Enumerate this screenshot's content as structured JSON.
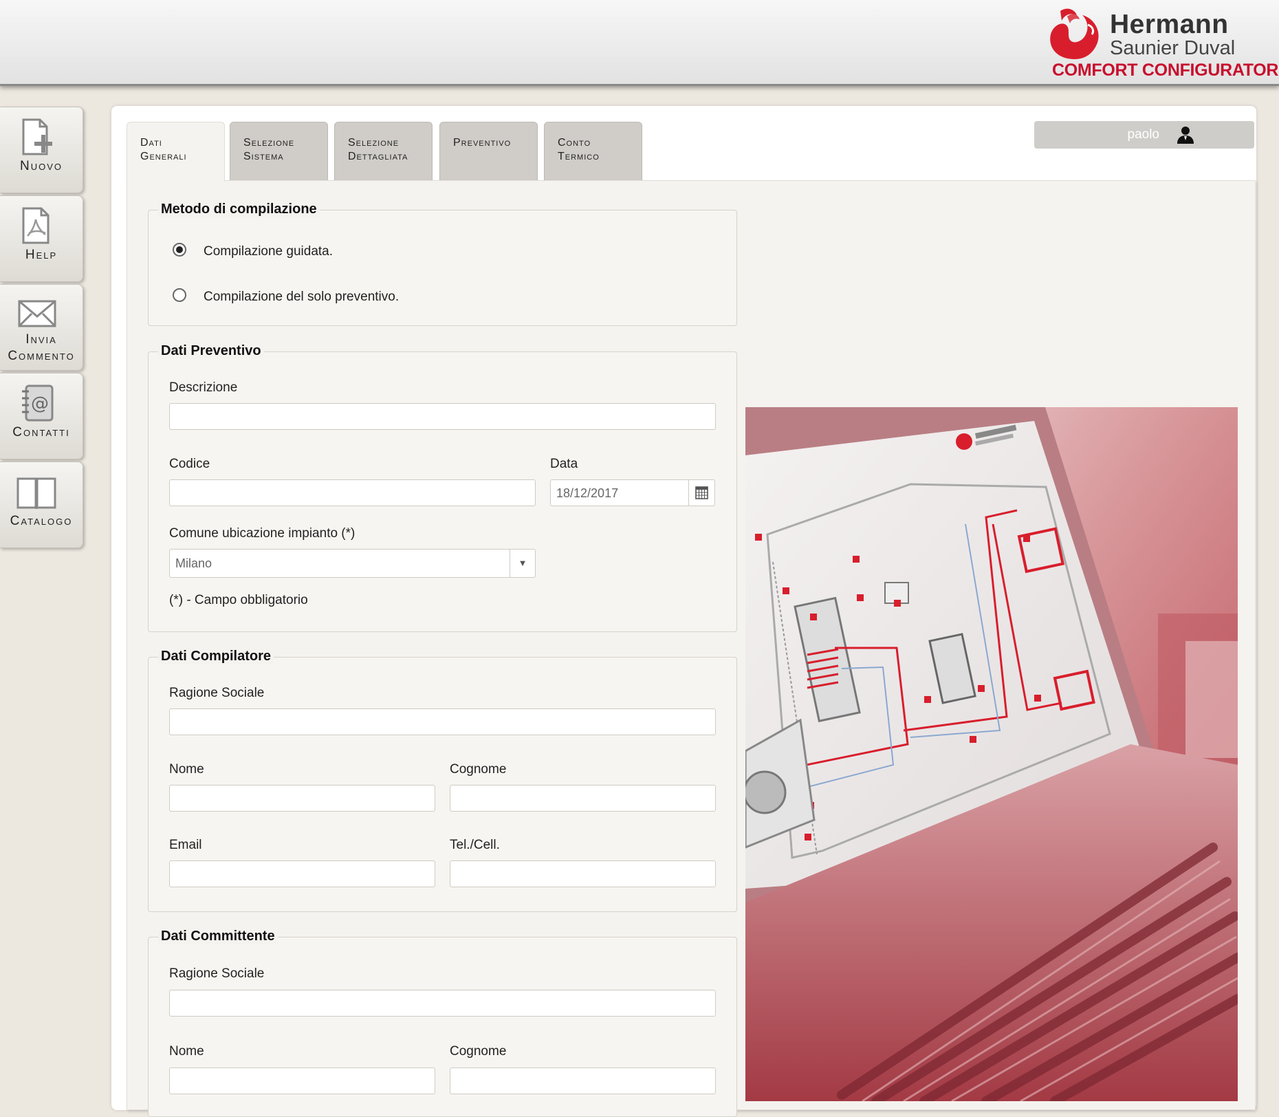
{
  "brand": {
    "line1": "Hermann",
    "line2": "Saunier Duval",
    "line3": "COMFORT CONFIGURATOR",
    "color": "#c8102e"
  },
  "sidebar": {
    "items": [
      {
        "label": "Nuovo",
        "icon": "new-document-icon"
      },
      {
        "label": "Help",
        "icon": "pdf-document-icon"
      },
      {
        "label": "Invia\nCommento",
        "icon": "envelope-icon"
      },
      {
        "label": "Contatti",
        "icon": "address-book-icon"
      },
      {
        "label": "Catalogo",
        "icon": "open-book-icon"
      }
    ]
  },
  "tabs": [
    {
      "label": "Dati\nGenerali",
      "active": true
    },
    {
      "label": "Selezione\nSistema",
      "active": false
    },
    {
      "label": "Selezione\nDettagliata",
      "active": false
    },
    {
      "label": "Preventivo",
      "active": false
    },
    {
      "label": "Conto\nTermico",
      "active": false
    }
  ],
  "user": {
    "name": "paolo",
    "icon": "user-icon"
  },
  "metodo": {
    "legend": "Metodo di compilazione",
    "options": [
      {
        "label": "Compilazione guidata.",
        "selected": true
      },
      {
        "label": "Compilazione del solo preventivo.",
        "selected": false
      }
    ]
  },
  "preventivo": {
    "legend": "Dati Preventivo",
    "descrizione_label": "Descrizione",
    "descrizione_value": "",
    "codice_label": "Codice",
    "codice_value": "",
    "data_label": "Data",
    "data_value": "18/12/2017",
    "comune_label": "Comune ubicazione impianto (*)",
    "comune_value": "Milano",
    "note": "(*) - Campo obbligatorio"
  },
  "compilatore": {
    "legend": "Dati Compilatore",
    "ragione_label": "Ragione Sociale",
    "nome_label": "Nome",
    "cognome_label": "Cognome",
    "email_label": "Email",
    "tel_label": "Tel./Cell."
  },
  "committente": {
    "legend": "Dati Committente",
    "ragione_label": "Ragione Sociale",
    "nome_label": "Nome",
    "cognome_label": "Cognome"
  }
}
